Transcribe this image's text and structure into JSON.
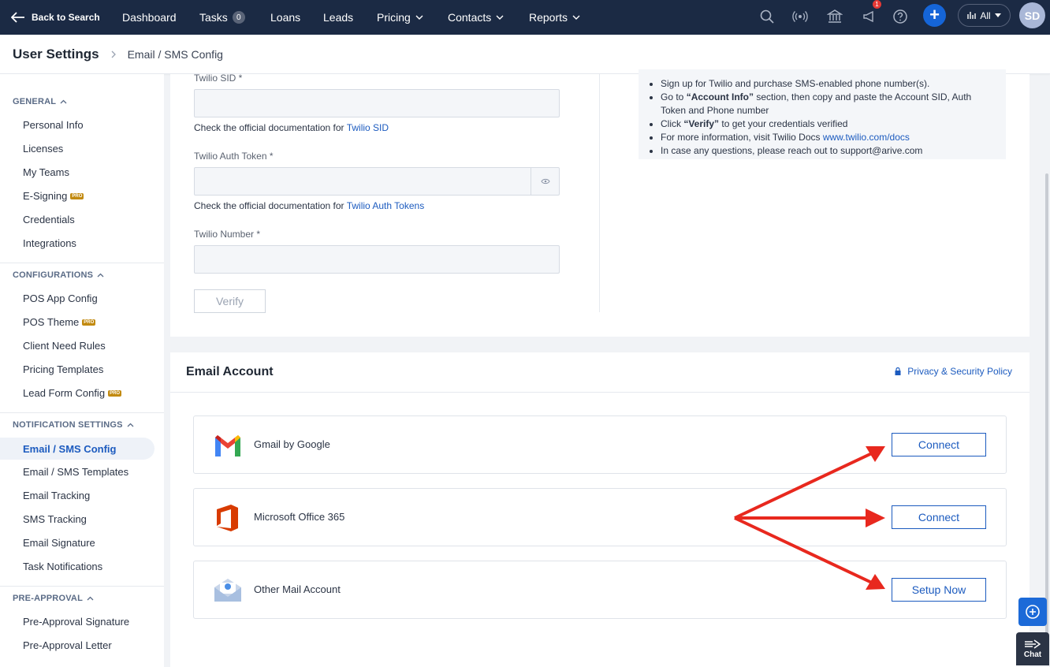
{
  "nav": {
    "back_label": "Back to Search",
    "items": [
      {
        "label": "Dashboard"
      },
      {
        "label": "Tasks",
        "badge": "0"
      },
      {
        "label": "Loans"
      },
      {
        "label": "Leads"
      },
      {
        "label": "Pricing"
      },
      {
        "label": "Contacts"
      },
      {
        "label": "Reports"
      }
    ],
    "notification_count": "1",
    "scope_label": "All",
    "avatar_initials": "SD",
    "accent_color": "#1565d8"
  },
  "header": {
    "title": "User Settings",
    "breadcrumb": "Email / SMS Config"
  },
  "sidebar": {
    "general": {
      "label": "GENERAL",
      "items": [
        "Personal Info",
        "Licenses",
        "My Teams",
        "E-Signing",
        "Credentials",
        "Integrations"
      ]
    },
    "configurations": {
      "label": "CONFIGURATIONS",
      "items": [
        "POS App Config",
        "POS Theme",
        "Client Need Rules",
        "Pricing Templates",
        "Lead Form Config"
      ]
    },
    "notification": {
      "label": "NOTIFICATION SETTINGS",
      "items": [
        "Email / SMS Config",
        "Email / SMS Templates",
        "Email Tracking",
        "SMS Tracking",
        "Email Signature",
        "Task Notifications"
      ]
    },
    "preapproval": {
      "label": "PRE-APPROVAL",
      "items": [
        "Pre-Approval Signature",
        "Pre-Approval Letter"
      ]
    },
    "pro_badge": "PRO"
  },
  "twilio": {
    "sid_label": "Twilio SID *",
    "sid_value": "",
    "sid_help": "Check the official documentation for",
    "sid_link": "Twilio SID",
    "token_label": "Twilio Auth Token *",
    "token_value": "",
    "token_help": "Check the official documentation for",
    "token_link": "Twilio Auth Tokens",
    "number_label": "Twilio Number *",
    "number_value": "",
    "verify_label": "Verify",
    "info": {
      "l1": "Sign up for Twilio and purchase SMS-enabled phone number(s).",
      "l2a": "Go to ",
      "l2b": "“Account Info”",
      "l2c": " section, then copy and paste the Account SID, Auth Token and Phone number",
      "l3a": "Click ",
      "l3b": "“Verify”",
      "l3c": " to get your credentials verified",
      "l4a": "For more information, visit Twilio Docs ",
      "l4b": "www.twilio.com/docs",
      "l5a": "In case any questions, please reach out to ",
      "l5b": "support@arive.com"
    }
  },
  "email_account": {
    "title": "Email Account",
    "privacy_label": "Privacy & Security Policy",
    "accounts": [
      {
        "name": "Gmail by Google",
        "button": "Connect"
      },
      {
        "name": "Microsoft Office 365",
        "button": "Connect"
      },
      {
        "name": "Other Mail Account",
        "button": "Setup Now"
      }
    ]
  },
  "chat_label": "Chat",
  "annotation_color": "#e8281e"
}
